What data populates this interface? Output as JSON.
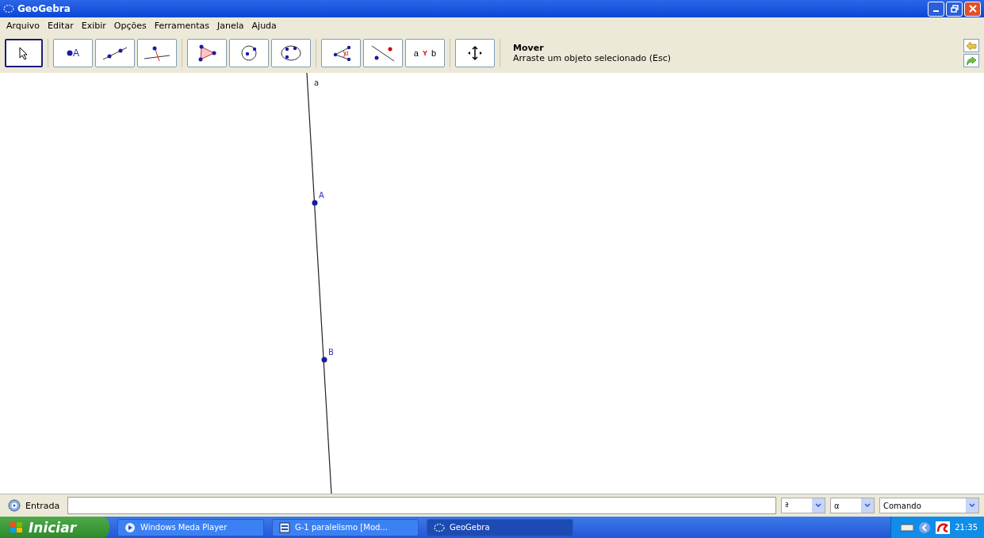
{
  "window": {
    "title": "GeoGebra"
  },
  "menu": [
    "Arquivo",
    "Editar",
    "Exibir",
    "Opções",
    "Ferramentas",
    "Janela",
    "Ajuda"
  ],
  "toolbar": {
    "groups": [
      [
        {
          "kind": "move",
          "selected": true
        }
      ],
      [
        {
          "kind": "point",
          "label": "A",
          "selected": false
        },
        {
          "kind": "line",
          "selected": false
        },
        {
          "kind": "perpendicular",
          "selected": false
        }
      ],
      [
        {
          "kind": "polygon",
          "selected": false
        },
        {
          "kind": "circle",
          "selected": false
        },
        {
          "kind": "conic",
          "selected": false
        }
      ],
      [
        {
          "kind": "angle",
          "label": "α",
          "selected": false
        },
        {
          "kind": "reflect",
          "selected": false
        },
        {
          "kind": "slider",
          "label_left": "a",
          "label_right": "b",
          "label_mid": "Y",
          "selected": false
        }
      ],
      [
        {
          "kind": "translate",
          "selected": false
        }
      ]
    ],
    "tool_name": "Mover",
    "tool_help": "Arraste um objeto selecionado (Esc)"
  },
  "canvas": {
    "line_label": "a",
    "points": [
      {
        "label": "A"
      },
      {
        "label": "B"
      }
    ]
  },
  "input_bar": {
    "label": "Entrada",
    "dropdowns": [
      "ª",
      "α",
      "Comando"
    ]
  },
  "taskbar": {
    "start": "Iniciar",
    "tasks": [
      {
        "label": "Windows Meda Player",
        "kind": "media",
        "selected": false
      },
      {
        "label": "G-1 paralelismo [Mod...",
        "kind": "doc",
        "selected": false
      },
      {
        "label": "GeoGebra",
        "kind": "geogebra",
        "selected": true
      }
    ],
    "clock": "21:35"
  }
}
